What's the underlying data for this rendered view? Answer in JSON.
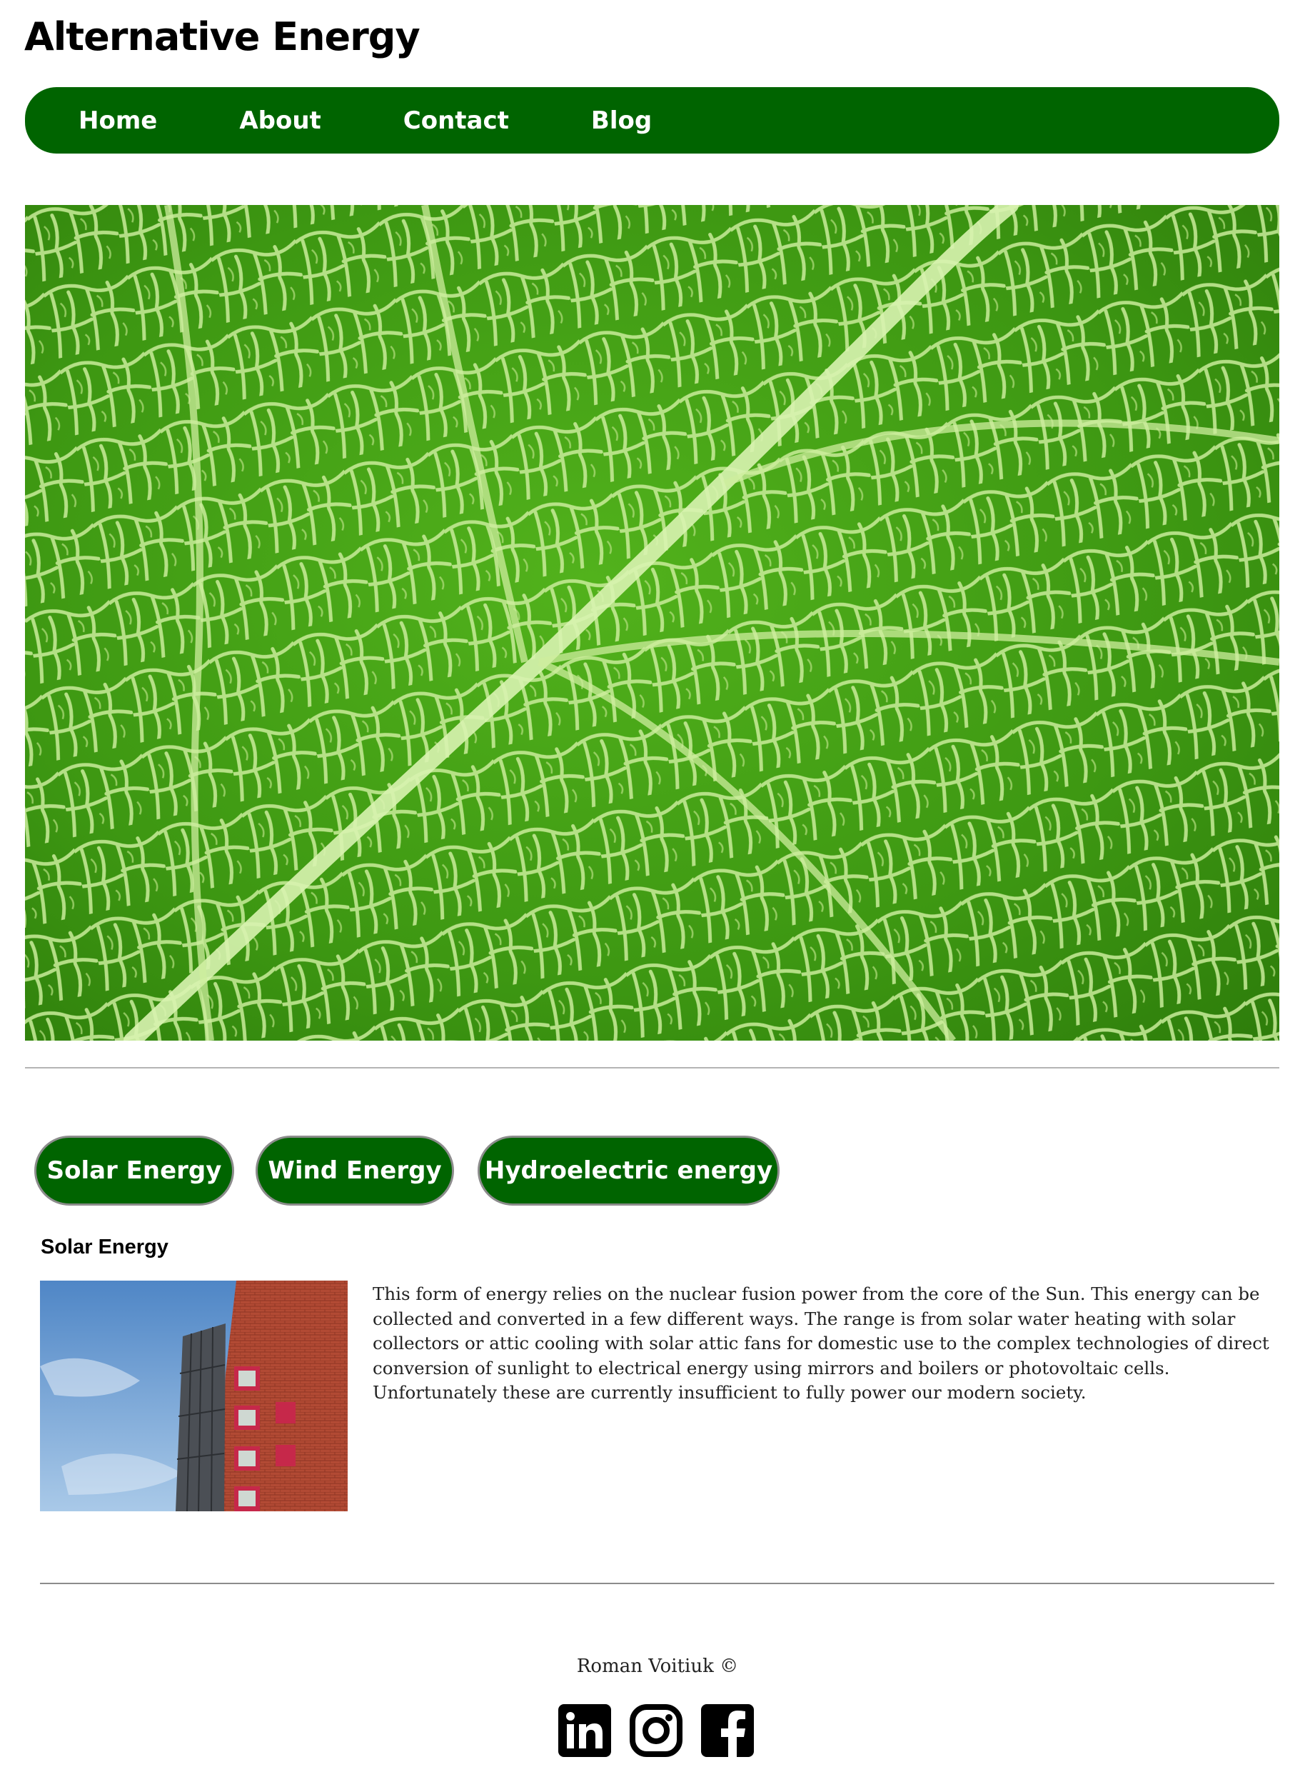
{
  "header": {
    "title": "Alternative Energy"
  },
  "nav": {
    "items": [
      {
        "label": "Home"
      },
      {
        "label": "About"
      },
      {
        "label": "Contact"
      },
      {
        "label": "Blog"
      }
    ],
    "color": "#006400"
  },
  "hero": {
    "icon": "green-leaf-macro-image"
  },
  "tabs": [
    {
      "label": "Solar Energy"
    },
    {
      "label": "Wind Energy"
    },
    {
      "label": "Hydroelectric energy"
    }
  ],
  "section": {
    "heading": "Solar Energy",
    "image_icon": "solar-panel-building-photo",
    "text": "This form of energy relies on the nuclear fusion power from the core of the Sun. This energy can be collected and converted in a few different ways. The range is from solar water heating with solar collectors or attic cooling with solar attic fans for domestic use to the complex technologies of direct conversion of sunlight to electrical energy using mirrors and boilers or photovoltaic cells. Unfortunately these are currently insufficient to fully power our modern society."
  },
  "footer": {
    "credit": "Roman Voitiuk ©",
    "social": [
      {
        "icon": "linkedin-icon"
      },
      {
        "icon": "instagram-icon"
      },
      {
        "icon": "facebook-icon"
      }
    ]
  }
}
